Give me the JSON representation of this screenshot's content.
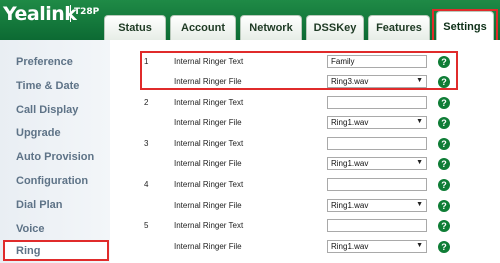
{
  "brand": {
    "name": "Yealink",
    "model": "T28P"
  },
  "tabs": [
    {
      "label": "Status"
    },
    {
      "label": "Account"
    },
    {
      "label": "Network"
    },
    {
      "label": "DSSKey"
    },
    {
      "label": "Features"
    },
    {
      "label": "Settings",
      "active": true
    }
  ],
  "sidebar": {
    "items": [
      {
        "label": "Preference"
      },
      {
        "label": "Time & Date"
      },
      {
        "label": "Call Display"
      },
      {
        "label": "Upgrade"
      },
      {
        "label": "Auto Provision"
      },
      {
        "label": "Configuration"
      },
      {
        "label": "Dial Plan"
      },
      {
        "label": "Voice"
      },
      {
        "label": "Ring",
        "active": true
      }
    ]
  },
  "ringers": [
    {
      "index": "1",
      "text_label": "Internal Ringer Text",
      "text_value": "Family",
      "file_label": "Internal Ringer File",
      "file_value": "Ring3.wav"
    },
    {
      "index": "2",
      "text_label": "Internal Ringer Text",
      "text_value": "",
      "file_label": "Internal Ringer File",
      "file_value": "Ring1.wav"
    },
    {
      "index": "3",
      "text_label": "Internal Ringer Text",
      "text_value": "",
      "file_label": "Internal Ringer File",
      "file_value": "Ring1.wav"
    },
    {
      "index": "4",
      "text_label": "Internal Ringer Text",
      "text_value": "",
      "file_label": "Internal Ringer File",
      "file_value": "Ring1.wav"
    },
    {
      "index": "5",
      "text_label": "Internal Ringer Text",
      "text_value": "",
      "file_label": "Internal Ringer File",
      "file_value": "Ring1.wav"
    }
  ],
  "help_glyph": "?",
  "icons": {
    "help": "help-icon",
    "dropdown": "chevron-down-icon"
  },
  "colors": {
    "header": "#0c6a33",
    "highlight": "#e02b2b",
    "help": "#0f7d36",
    "sidebar_text": "#5e7387"
  }
}
